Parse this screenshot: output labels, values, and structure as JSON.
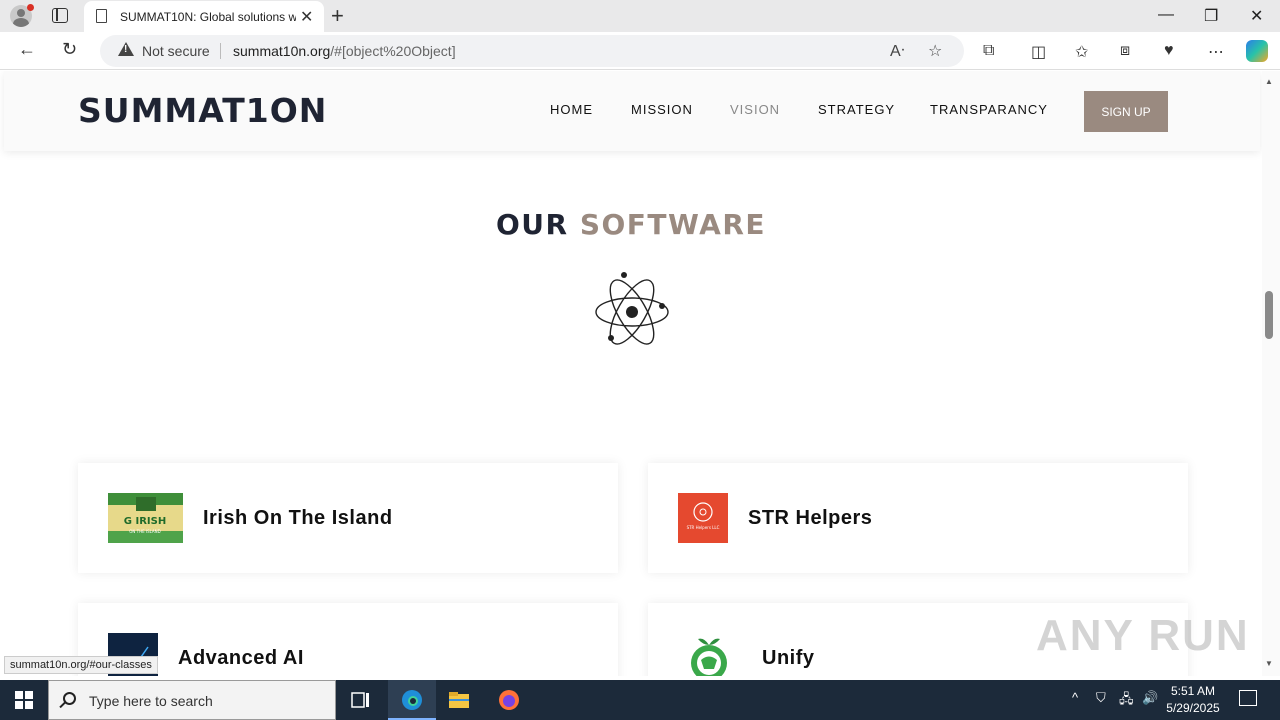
{
  "browser": {
    "tab_title": "SUMMAT10N: Global solutions w",
    "new_tab": "+",
    "close": "✕",
    "security": "Not secure",
    "url_host": "summat10n.org",
    "url_rest": "/#[object%20Object]",
    "status_url": "summat10n.org/#our-classes"
  },
  "site": {
    "logo": "SUMMAT1ON",
    "nav": [
      "HOME",
      "MISSION",
      "VISION",
      "STRATEGY",
      "TRANSPARANCY"
    ],
    "active_nav": "VISION",
    "signup": "SIGN UP",
    "section_title_a": "OUR",
    "section_title_b": "SOFTWARE",
    "cards": [
      {
        "title": "Irish On The Island",
        "thumb_text": "G IRISH",
        "thumb_sub": "ON THE ISLAND"
      },
      {
        "title": "STR Helpers",
        "thumb_text": "STR Helpers LLC"
      },
      {
        "title": "Advanced AI"
      },
      {
        "title": "Unify"
      }
    ],
    "accent": "#9a8a80",
    "dark": "#1f2433"
  },
  "watermark": "ANY RUN",
  "taskbar": {
    "search_placeholder": "Type here to search",
    "time": "5:51 AM",
    "date": "5/29/2025"
  }
}
